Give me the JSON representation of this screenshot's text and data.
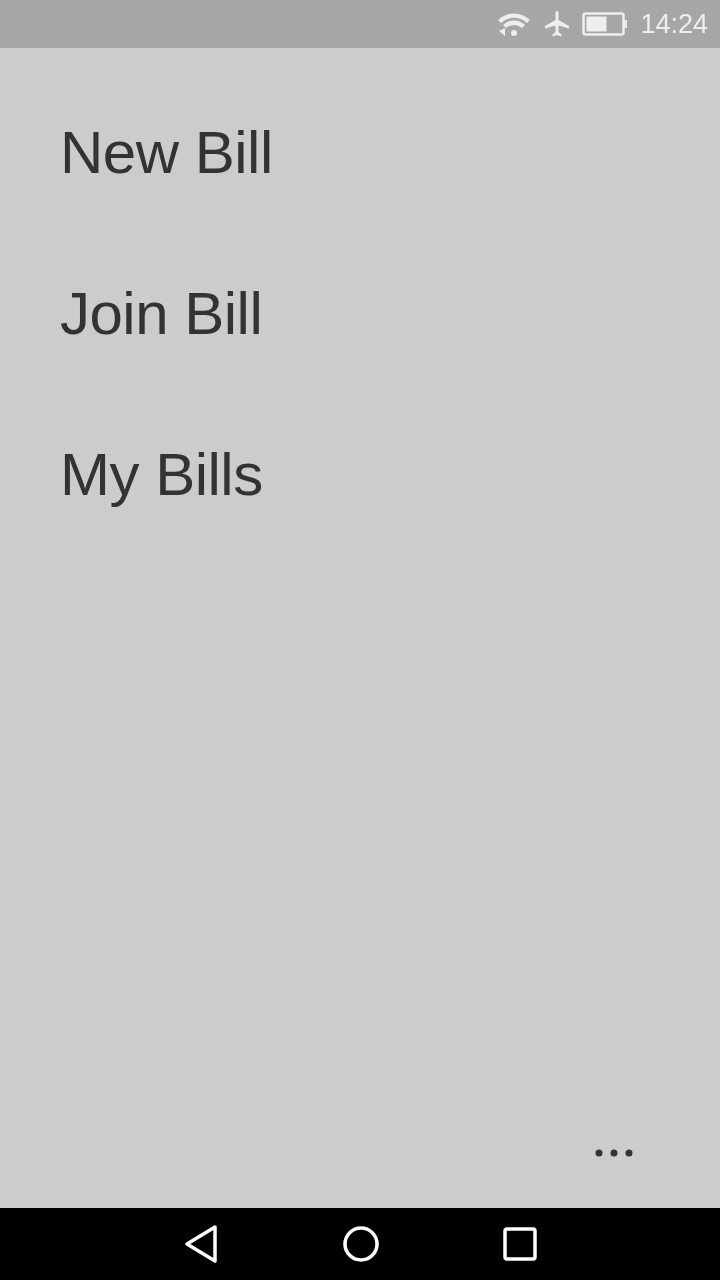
{
  "status_bar": {
    "time": "14:24"
  },
  "menu": [
    {
      "label": "New Bill"
    },
    {
      "label": "Join Bill"
    },
    {
      "label": "My Bills"
    }
  ]
}
